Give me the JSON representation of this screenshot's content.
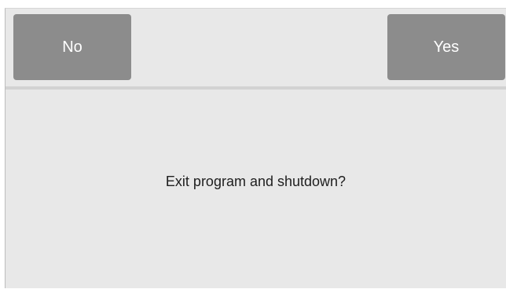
{
  "dialog": {
    "buttons": {
      "no_label": "No",
      "yes_label": "Yes"
    },
    "message": "Exit program and shutdown?"
  },
  "colors": {
    "background": "#e8e8e8",
    "button": "#8c8c8c",
    "button_text": "#ffffff",
    "message_text": "#1e1e1e",
    "divider": "#d2d2d2"
  }
}
